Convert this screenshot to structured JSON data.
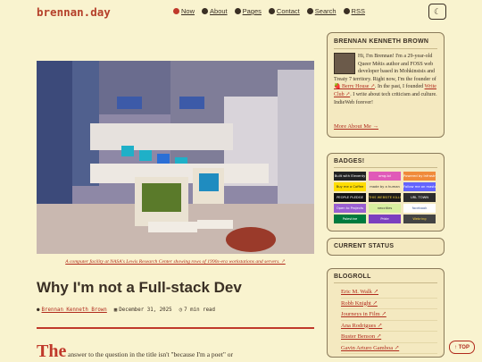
{
  "site": {
    "logo": "brennan.day"
  },
  "nav": [
    {
      "label": "Now",
      "icon": "record-dot-icon"
    },
    {
      "label": "About",
      "icon": "info-icon"
    },
    {
      "label": "Pages",
      "icon": "stack-icon"
    },
    {
      "label": "Contact",
      "icon": "envelope-icon"
    },
    {
      "label": "Search",
      "icon": "search-icon"
    },
    {
      "label": "RSS",
      "icon": "rss-icon"
    }
  ],
  "theme_toggle": {
    "icon": "moon-icon"
  },
  "post": {
    "caption": "A computer facility at NASA's Lewis Research Center showing rows of 1990s-era workstations and servers. ↗",
    "title": "Why I'm not a Full-stack Dev",
    "author": "Brennan Kenneth Brown",
    "date": "December 31, 2025",
    "read_time": "7 min read",
    "dropcap": "The",
    "intro": "answer to the question in the title isn't \"because I'm a poet\" or"
  },
  "sidebar": {
    "about": {
      "heading": "BRENNAN KENNETH BROWN",
      "bio_start": "Hi, I'm Brennan! I'm a 29-year-old Queer Métis author and FOSS web developer based in Mohkinstsis and Treaty 7 territory. Right now, I'm the founder of ",
      "berry_house": "🍓 Berry House ↗",
      "bio_mid": ". In the past, I founded ",
      "write_club": "Write Club ↗",
      "bio_end": ". I write about tech criticism and culture. IndieWeb forever!",
      "more_link": "More About Me →"
    },
    "badges": {
      "heading": "BADGES!",
      "items": [
        {
          "text": "Built with Eleventy",
          "bg": "#222222",
          "fg": "#ffffff"
        },
        {
          "text": "omg.lol",
          "bg": "#e05ab8",
          "fg": "#ffffff"
        },
        {
          "text": "Powered by Infrastruct",
          "bg": "#f08a3a",
          "fg": "#ffffff"
        },
        {
          "text": "Buy me a Coffee",
          "bg": "#ffdd00",
          "fg": "#222222"
        },
        {
          "text": "made by a human",
          "bg": "#f6e6b8",
          "fg": "#333333"
        },
        {
          "text": "Follow me on mastodon",
          "bg": "#6364ff",
          "fg": "#ffffff"
        },
        {
          "text": "PEOPLE PLEDGE",
          "bg": "#111111",
          "fg": "#ffffff"
        },
        {
          "text": "THIS WEBSITE KILLS FASCISTS",
          "bg": "#1a1a1a",
          "fg": "#f4d03f"
        },
        {
          "text": "URL TOWN",
          "bg": "#2d2d2d",
          "fg": "#ffffff"
        },
        {
          "text": "Open to Projects",
          "bg": "#9a5fd1",
          "fg": "#ffffff"
        },
        {
          "text": "neocities",
          "bg": "#d8f0a0",
          "fg": "#333333"
        },
        {
          "text": "facebook",
          "bg": "#ffffff",
          "fg": "#3b5998"
        },
        {
          "text": "Palestine",
          "bg": "#007a3d",
          "fg": "#ffffff"
        },
        {
          "text": "Pride",
          "bg": "#7b3fbf",
          "fg": "#ffffff"
        },
        {
          "text": "Webring",
          "bg": "#444444",
          "fg": "#f4d03f"
        }
      ]
    },
    "status": {
      "heading": "CURRENT STATUS"
    },
    "blogroll": {
      "heading": "BLOGROLL",
      "items": [
        "Eric M. Walk ↗",
        "Robb Knight ↗",
        "Journeys in Film ↗",
        "Ana Rodrigues ↗",
        "Buster Benson ↗",
        "Gavin Arturo Gamboa ↗"
      ]
    }
  },
  "top_button": {
    "label": "↑ TOP"
  }
}
